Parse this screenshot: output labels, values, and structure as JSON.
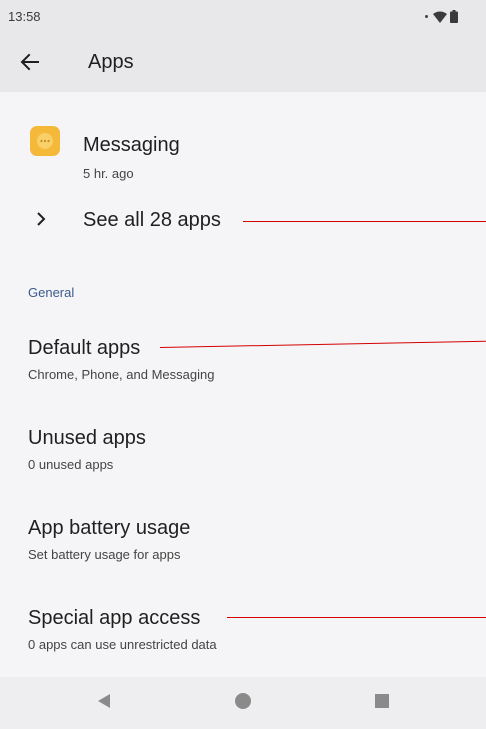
{
  "status_bar": {
    "time": "13:58"
  },
  "app_bar": {
    "title": "Apps"
  },
  "recent_app": {
    "name": "Messaging",
    "time": "5 hr. ago",
    "icon_color": "#f5b93a"
  },
  "see_all": {
    "label": "See all 28 apps"
  },
  "section": {
    "general": "General"
  },
  "items": [
    {
      "title": "Default apps",
      "subtitle": "Chrome, Phone, and Messaging"
    },
    {
      "title": "Unused apps",
      "subtitle": "0 unused apps"
    },
    {
      "title": "App battery usage",
      "subtitle": "Set battery usage for apps"
    },
    {
      "title": "Special app access",
      "subtitle": "0 apps can use unrestricted data"
    }
  ],
  "colors": {
    "accent_section": "#3b5b8c",
    "annotation": "#d40000"
  },
  "icons": {
    "back": "arrow-left-icon",
    "chevron": "chevron-right-icon",
    "nav_back": "triangle-back-icon",
    "nav_home": "circle-home-icon",
    "nav_recents": "square-recents-icon"
  }
}
